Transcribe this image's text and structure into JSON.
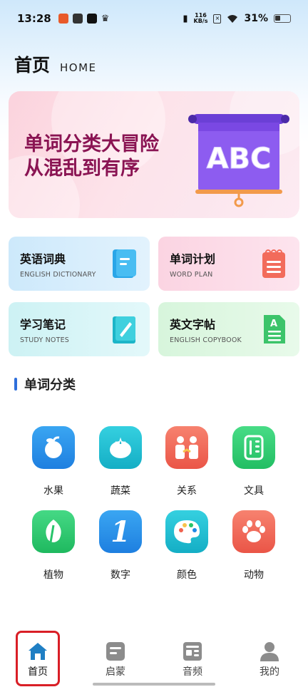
{
  "status_bar": {
    "time": "13:28",
    "net_speed_value": "116",
    "net_speed_unit": "KB/s",
    "battery_percent": "31%"
  },
  "header": {
    "title": "首页",
    "subtitle": "HOME"
  },
  "banner": {
    "line1": "单词分类大冒险",
    "line2": "从混乱到有序",
    "board_text": "ABC"
  },
  "features": [
    {
      "title": "英语词典",
      "subtitle": "ENGLISH DICTIONARY",
      "icon": "dictionary-icon",
      "color": "#2aa6e8"
    },
    {
      "title": "单词计划",
      "subtitle": "WORD PLAN",
      "icon": "notepad-icon",
      "color": "#f26b5b"
    },
    {
      "title": "学习笔记",
      "subtitle": "STUDY NOTES",
      "icon": "notebook-pen-icon",
      "color": "#1cb5c8"
    },
    {
      "title": "英文字帖",
      "subtitle": "ENGLISH COPYBOOK",
      "icon": "copybook-icon",
      "color": "#3cc46a"
    }
  ],
  "section": {
    "title": "单词分类"
  },
  "categories": [
    {
      "label": "水果",
      "icon": "apple-icon",
      "color": "#1e88e5"
    },
    {
      "label": "蔬菜",
      "icon": "tomato-icon",
      "color": "#19b6c9"
    },
    {
      "label": "关系",
      "icon": "people-icon",
      "color": "#f0624f"
    },
    {
      "label": "文具",
      "icon": "stationery-icon",
      "color": "#2ecc71"
    },
    {
      "label": "植物",
      "icon": "leaf-icon",
      "color": "#27c46a"
    },
    {
      "label": "数字",
      "icon": "number-one-icon",
      "color": "#1e88e5"
    },
    {
      "label": "颜色",
      "icon": "palette-icon",
      "color": "#19b6c9"
    },
    {
      "label": "动物",
      "icon": "paw-icon",
      "color": "#f0624f"
    }
  ],
  "number_glyph": "1",
  "bottom_nav": [
    {
      "label": "首页",
      "icon": "home-icon",
      "active": true
    },
    {
      "label": "启蒙",
      "icon": "enlighten-icon",
      "active": false
    },
    {
      "label": "音频",
      "icon": "audio-icon",
      "active": false
    },
    {
      "label": "我的",
      "icon": "profile-icon",
      "active": false
    }
  ],
  "colors": {
    "accent": "#2f6fdb",
    "banner_text": "#8a1453",
    "active_border": "#d91e26",
    "home_icon": "#1f7fc4"
  }
}
